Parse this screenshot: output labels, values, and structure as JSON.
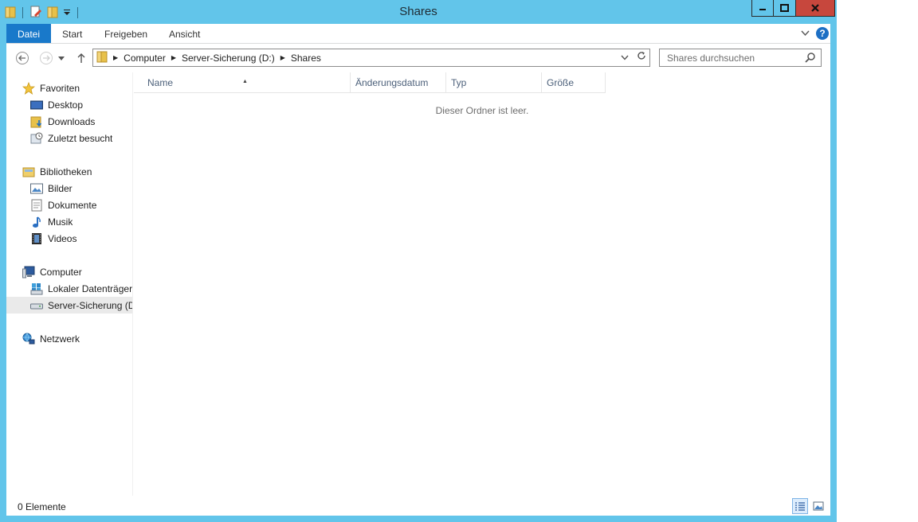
{
  "window": {
    "title": "Shares",
    "controls": {
      "minimize_icon": "minimize-icon",
      "maximize_icon": "maximize-icon",
      "close_icon": "close-icon"
    }
  },
  "ribbon": {
    "tabs": [
      "Datei",
      "Start",
      "Freigeben",
      "Ansicht"
    ],
    "help": "?"
  },
  "address": {
    "crumbs": [
      "Computer",
      "Server-Sicherung (D:)",
      "Shares"
    ]
  },
  "search": {
    "placeholder": "Shares durchsuchen"
  },
  "nav": {
    "favorites": {
      "label": "Favoriten",
      "items": [
        "Desktop",
        "Downloads",
        "Zuletzt besucht"
      ]
    },
    "libraries": {
      "label": "Bibliotheken",
      "items": [
        "Bilder",
        "Dokumente",
        "Musik",
        "Videos"
      ]
    },
    "computer": {
      "label": "Computer",
      "items": [
        "Lokaler Datenträger",
        "Server-Sicherung (D:)"
      ]
    },
    "network": {
      "label": "Netzwerk"
    }
  },
  "columns": [
    "Name",
    "Änderungsdatum",
    "Typ",
    "Größe"
  ],
  "empty_message": "Dieser Ordner ist leer.",
  "status": {
    "count": "0 Elemente"
  },
  "colors": {
    "frame": "#62c5ea",
    "close": "#c7473d",
    "file_tab": "#1979ca"
  }
}
